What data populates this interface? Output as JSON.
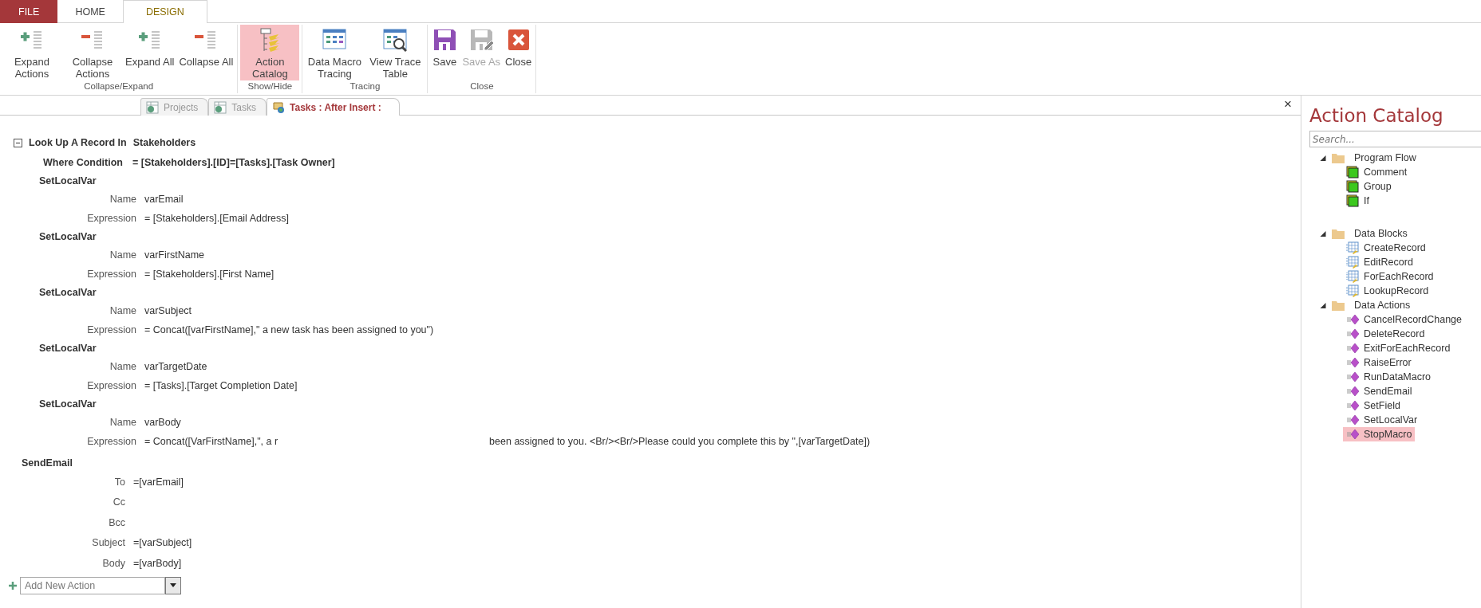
{
  "ribbon": {
    "tabs": [
      {
        "label": "FILE",
        "kind": "file",
        "selected": false
      },
      {
        "label": "HOME",
        "kind": "tab",
        "selected": false
      },
      {
        "label": "DESIGN",
        "kind": "tab",
        "selected": true
      }
    ],
    "groups": [
      {
        "label": "Collapse/Expand",
        "buttons": [
          {
            "label": "Expand Actions",
            "kind": "plus-lines",
            "active": false,
            "disabled": false
          },
          {
            "label": "Collapse Actions",
            "kind": "minus-lines",
            "active": false,
            "disabled": false
          },
          {
            "label": "Expand All",
            "kind": "plus-lines",
            "active": false,
            "disabled": false
          },
          {
            "label": "Collapse All",
            "kind": "minus-lines",
            "active": false,
            "disabled": false
          }
        ]
      },
      {
        "label": "Show/Hide",
        "buttons": [
          {
            "label": "Action Catalog",
            "kind": "catalog",
            "active": true,
            "disabled": false
          }
        ]
      },
      {
        "label": "Tracing",
        "buttons": [
          {
            "label": "Data Macro Tracing",
            "kind": "tracing",
            "active": false,
            "disabled": false
          },
          {
            "label": "View Trace Table",
            "kind": "trace-table",
            "active": false,
            "disabled": false
          }
        ]
      },
      {
        "label": "Close",
        "buttons": [
          {
            "label": "Save",
            "kind": "save",
            "active": false,
            "disabled": false
          },
          {
            "label": "Save As",
            "kind": "save-as",
            "active": false,
            "disabled": true
          },
          {
            "label": "Close",
            "kind": "close",
            "active": false,
            "disabled": false
          }
        ]
      }
    ]
  },
  "document_tabs": [
    {
      "label": "Projects",
      "kind": "table",
      "selected": false
    },
    {
      "label": "Tasks",
      "kind": "table",
      "selected": false
    },
    {
      "label": "Tasks : After Insert :",
      "kind": "macro",
      "selected": true
    }
  ],
  "close_glyph": "×",
  "macro": {
    "block": {
      "label": "Look Up A Record In",
      "table": "Stakeholders",
      "expanded": true,
      "where_label": "Where Condition",
      "where_value": "= [Stakeholders].[ID]=[Tasks].[Task Owner]",
      "actions": [
        {
          "name": "SetLocalVar",
          "args": [
            {
              "label": "Name",
              "value": "varEmail"
            },
            {
              "label": "Expression",
              "value": "= [Stakeholders].[Email Address]"
            }
          ]
        },
        {
          "name": "SetLocalVar",
          "args": [
            {
              "label": "Name",
              "value": "varFirstName"
            },
            {
              "label": "Expression",
              "value": "= [Stakeholders].[First Name]"
            }
          ]
        },
        {
          "name": "SetLocalVar",
          "args": [
            {
              "label": "Name",
              "value": "varSubject"
            },
            {
              "label": "Expression",
              "value": "= Concat([varFirstName],\" a new task has been assigned to you\")"
            }
          ]
        },
        {
          "name": "SetLocalVar",
          "args": [
            {
              "label": "Name",
              "value": "varTargetDate"
            },
            {
              "label": "Expression",
              "value": "= [Tasks].[Target Completion Date]"
            }
          ]
        },
        {
          "name": "SetLocalVar",
          "args": [
            {
              "label": "Name",
              "value": "varBody"
            },
            {
              "label": "Expression",
              "segments": [
                "= Concat([VarFirstName],\", a r",
                "been assigned to you. <Br/><Br/>Please could you complete this by \",[varTargetDate])"
              ]
            }
          ]
        }
      ]
    },
    "actions": [
      {
        "name": "SendEmail",
        "args": [
          {
            "label": "To",
            "value": "=[varEmail]"
          },
          {
            "label": "Cc"
          },
          {
            "label": "Bcc"
          },
          {
            "label": "Subject",
            "value": "=[varSubject]"
          },
          {
            "label": "Body",
            "value": "=[varBody]"
          }
        ]
      }
    ],
    "add_action": {
      "placeholder": "Add New Action"
    }
  },
  "catalog": {
    "title": "Action Catalog",
    "search": {
      "placeholder": "Search..."
    },
    "groups": [
      {
        "label": "Program Flow",
        "expanded": true,
        "children": [
          {
            "label": "Comment",
            "kind": "flow",
            "selected": false
          },
          {
            "label": "Group",
            "kind": "flow",
            "selected": false
          },
          {
            "label": "If",
            "kind": "flow",
            "selected": false
          }
        ]
      },
      {
        "label": "Data Blocks",
        "expanded": true,
        "children": [
          {
            "label": "CreateRecord",
            "kind": "block",
            "selected": false
          },
          {
            "label": "EditRecord",
            "kind": "block",
            "selected": false
          },
          {
            "label": "ForEachRecord",
            "kind": "block",
            "selected": false
          },
          {
            "label": "LookupRecord",
            "kind": "block",
            "selected": false
          }
        ]
      },
      {
        "label": "Data Actions",
        "expanded": true,
        "children": [
          {
            "label": "CancelRecordChange",
            "kind": "action",
            "selected": false
          },
          {
            "label": "DeleteRecord",
            "kind": "action",
            "selected": false
          },
          {
            "label": "ExitForEachRecord",
            "kind": "action",
            "selected": false
          },
          {
            "label": "RaiseError",
            "kind": "action",
            "selected": false
          },
          {
            "label": "RunDataMacro",
            "kind": "action",
            "selected": false
          },
          {
            "label": "SendEmail",
            "kind": "action",
            "selected": false
          },
          {
            "label": "SetField",
            "kind": "action",
            "selected": false
          },
          {
            "label": "SetLocalVar",
            "kind": "action",
            "selected": false
          },
          {
            "label": "StopMacro",
            "kind": "action",
            "selected": true
          }
        ]
      }
    ]
  }
}
